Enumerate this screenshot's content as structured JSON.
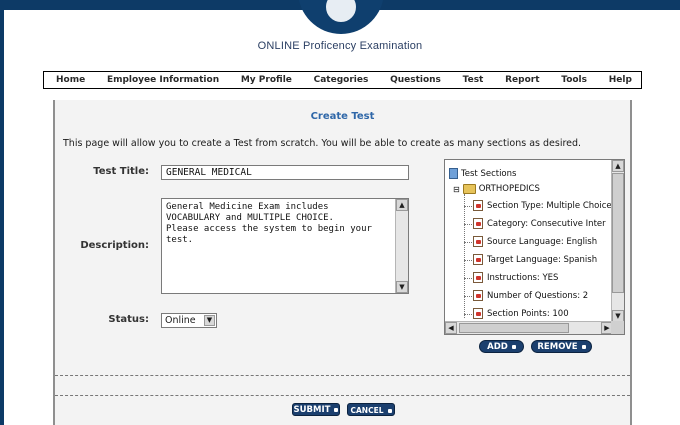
{
  "header": {
    "site_title": "ONLINE Proficency Examination"
  },
  "nav": {
    "items": [
      {
        "label": "Home",
        "name": "nav-home"
      },
      {
        "label": "Employee Information",
        "name": "nav-employee-information"
      },
      {
        "label": "My Profile",
        "name": "nav-my-profile"
      },
      {
        "label": "Categories",
        "name": "nav-categories"
      },
      {
        "label": "Questions",
        "name": "nav-questions"
      },
      {
        "label": "Test",
        "name": "nav-test"
      },
      {
        "label": "Report",
        "name": "nav-report"
      },
      {
        "label": "Tools",
        "name": "nav-tools"
      },
      {
        "label": "Help",
        "name": "nav-help"
      }
    ]
  },
  "page": {
    "title": "Create Test",
    "intro": "This page will allow you to create a Test from scratch.  You will be able to create as many sections as desired."
  },
  "form": {
    "test_title_label": "Test Title:",
    "test_title_value": "GENERAL MEDICAL",
    "description_label": "Description:",
    "description_value": "General Medicine Exam includes\nVOCABULARY and MULTIPLE CHOICE.\nPlease access the system to begin your test.",
    "status_label": "Status:",
    "status_value": "Online"
  },
  "tree": {
    "root_label": "Test Sections",
    "folder_label": "ORTHOPEDICS",
    "items": [
      "Section Type: Multiple Choice",
      "Category: Consecutive Inter",
      "Source Language: English",
      "Target Language: Spanish",
      "Instructions: YES",
      "Number of Questions: 2",
      "Section Points: 100"
    ]
  },
  "buttons": {
    "add": "ADD",
    "remove": "REMOVE",
    "submit": "SUBMIT",
    "cancel": "CANCEL"
  },
  "colors": {
    "brand_navy": "#0d3a66",
    "title_blue": "#2f67a8",
    "button_navy": "#1b3f6e"
  }
}
